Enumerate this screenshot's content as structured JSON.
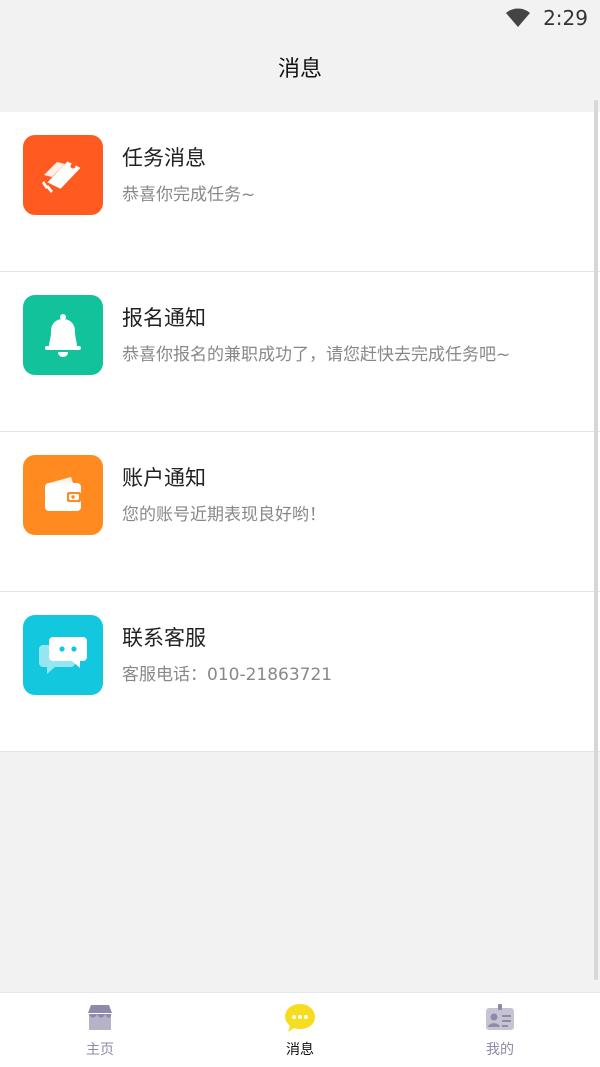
{
  "status_bar": {
    "time": "2:29"
  },
  "header": {
    "title": "消息"
  },
  "messages": [
    {
      "title": "任务消息",
      "subtitle": "恭喜你完成任务~",
      "icon": "tag-icon",
      "color": "#ff5a1f"
    },
    {
      "title": "报名通知",
      "subtitle": "恭喜你报名的兼职成功了，请您赶快去完成任务吧~",
      "icon": "bell-icon",
      "color": "#12c29a"
    },
    {
      "title": "账户通知",
      "subtitle": "您的账号近期表现良好哟！",
      "icon": "wallet-icon",
      "color": "#ff8a1f"
    },
    {
      "title": "联系客服",
      "subtitle": "客服电话：010-21863721",
      "icon": "chat-icon",
      "color": "#12c7de"
    }
  ],
  "bottom_nav": {
    "items": [
      {
        "label": "主页",
        "icon": "shop-icon",
        "active": false
      },
      {
        "label": "消息",
        "icon": "message-icon",
        "active": true
      },
      {
        "label": "我的",
        "icon": "profile-card-icon",
        "active": false
      }
    ],
    "active_color": "#f7dd1f",
    "inactive_color": "#8e8aa9"
  }
}
